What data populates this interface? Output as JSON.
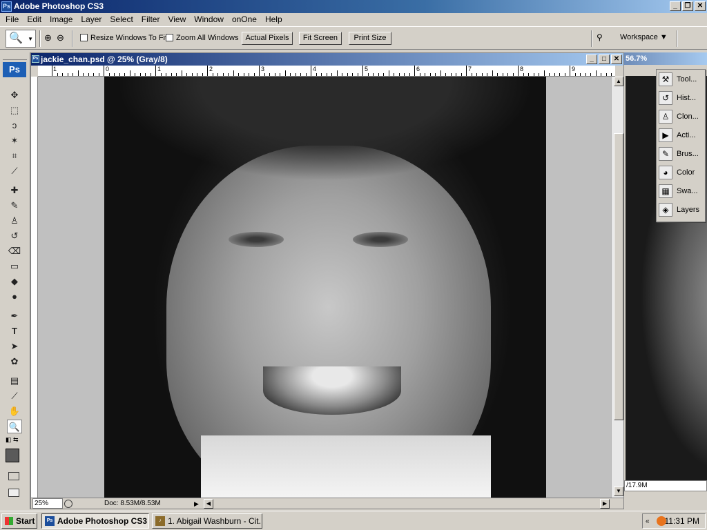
{
  "app": {
    "title": "Adobe Photoshop CS3",
    "icon": "photoshop-icon"
  },
  "menu": [
    "File",
    "Edit",
    "Image",
    "Layer",
    "Select",
    "Filter",
    "View",
    "Window",
    "onOne",
    "Help"
  ],
  "options": {
    "resize_windows": "Resize Windows To Fit",
    "zoom_all": "Zoom All Windows",
    "actual_pixels": "Actual Pixels",
    "fit_screen": "Fit Screen",
    "print_size": "Print Size",
    "workspace": "Workspace"
  },
  "document": {
    "title": "jackie_chan.psd @ 25% (Gray/8)",
    "zoom": "25%",
    "doc_size": "Doc: 8.53M/8.53M",
    "ruler": [
      "1",
      "0",
      "1",
      "2",
      "3",
      "4",
      "5",
      "6",
      "7",
      "8",
      "9"
    ]
  },
  "right_document": {
    "zoom": "56.7%",
    "doc_size": "/17.9M"
  },
  "panels": [
    {
      "label": "Tool...",
      "icon": "tool-presets-icon"
    },
    {
      "label": "Hist...",
      "icon": "history-icon"
    },
    {
      "label": "Clon...",
      "icon": "clone-source-icon"
    },
    {
      "label": "Acti...",
      "icon": "actions-icon"
    },
    {
      "label": "Brus...",
      "icon": "brushes-icon"
    },
    {
      "label": "Color",
      "icon": "color-icon"
    },
    {
      "label": "Swa...",
      "icon": "swatches-icon"
    },
    {
      "label": "Layers",
      "icon": "layers-icon"
    }
  ],
  "tools": [
    "move",
    "marquee",
    "lasso",
    "magic-wand",
    "crop",
    "slice",
    "healing",
    "brush",
    "stamp",
    "history-brush",
    "eraser",
    "gradient",
    "blur",
    "dodge",
    "pen",
    "type",
    "path-select",
    "shape",
    "notes",
    "eyedropper",
    "hand",
    "zoom"
  ],
  "taskbar": {
    "start": "Start",
    "task1": "Adobe Photoshop CS3",
    "task2": "1. Abigail Washburn - Cit...",
    "clock": "11:31 PM"
  }
}
